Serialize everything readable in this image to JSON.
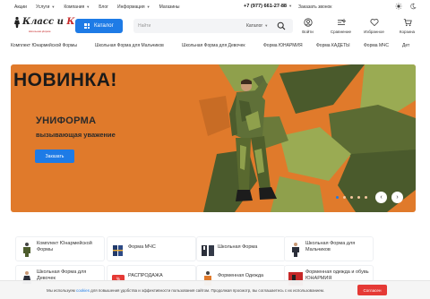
{
  "topbar": {
    "links": [
      {
        "label": "Акции",
        "has_menu": false
      },
      {
        "label": "Услуги",
        "has_menu": true
      },
      {
        "label": "Компания",
        "has_menu": true
      },
      {
        "label": "Блог",
        "has_menu": false
      },
      {
        "label": "Информация",
        "has_menu": true
      },
      {
        "label": "Магазины",
        "has_menu": false
      }
    ],
    "phone": "+7 (977) 661-27-88",
    "callback": "Заказать звонок"
  },
  "header": {
    "logo_name_1": "Класс",
    "logo_name_2": "и",
    "logo_name_3": "К",
    "logo_tagline": "Школьная форма",
    "catalog_label": "Каталог",
    "search_placeholder": "Найти",
    "search_scope": "Каталог",
    "actions": [
      {
        "label": "Войти",
        "icon": "user-icon"
      },
      {
        "label": "Сравнение",
        "icon": "compare-icon"
      },
      {
        "label": "Избранное",
        "icon": "heart-icon"
      },
      {
        "label": "Корзина",
        "icon": "cart-icon"
      }
    ]
  },
  "catnav": [
    "Комплект Юнармейской Формы",
    "Школьная Форма для Мальчиков",
    "Школьная Форма для Девочек",
    "Форма ЮНАРМИЯ",
    "Форма КАДЕТЫ",
    "Форма МЧС",
    "Дет"
  ],
  "hero": {
    "title": "НОВИНКА!",
    "subtitle": "УНИФОРМА",
    "tagline": "вызывающая уважение",
    "order_label": "Заказать",
    "slide_count": 5,
    "active_slide": 1,
    "prev_icon": "chevron-left-icon",
    "next_icon": "chevron-right-icon",
    "colors": {
      "background": "#e07a2b",
      "camo_dark": "#4a5a2c",
      "camo_light": "#8fa04c",
      "accent": "#1e7be6"
    }
  },
  "tiles": [
    {
      "label": "Комплект Юнармейской Формы",
      "icon": "uniform-icon"
    },
    {
      "label": "Форма МЧС",
      "icon": "rescue-uniform-icon"
    },
    {
      "label": "Школьная Форма",
      "icon": "school-uniform-icon"
    },
    {
      "label": "Школьная Форма для Мальчиков",
      "icon": "boys-uniform-icon"
    },
    {
      "label": "Школьная Форма для Девочек",
      "icon": "girls-uniform-icon"
    },
    {
      "label": "РАСПРОДАЖА",
      "icon": "sale-icon"
    },
    {
      "label": "Форменная Одежда",
      "icon": "workwear-icon"
    },
    {
      "label": "Форменная одежда и обувь ЮНАРМИЯ",
      "icon": "boots-icon"
    }
  ],
  "cookie": {
    "text_before": "Мы используем ",
    "link": "cookies",
    "text_after": " для повышения удобства и эффективности пользования сайтом. Продолжая просмотр, вы соглашаетесь с их использованием.",
    "accept_label": "Согласен"
  }
}
